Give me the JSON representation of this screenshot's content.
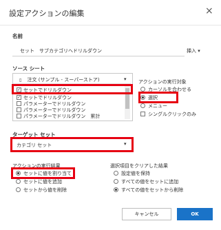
{
  "dialog": {
    "title": "設定アクションの編集",
    "close_glyph": "×"
  },
  "name_section": {
    "label": "名前",
    "value": "セット　サブカテゴリへドリルダウン",
    "insert_label": "挿入"
  },
  "source_sheet": {
    "label": "ソース シート",
    "datasource": "注文 (サンプル - スーパーストア)",
    "items": [
      {
        "label": "セットでドリルダウン",
        "checked": true
      },
      {
        "label": "セットでドリルダウン",
        "checked": true
      },
      {
        "label": "パラメーターでドリルダウン",
        "checked": false
      },
      {
        "label": "パラメーターでドリルダウン",
        "checked": false
      },
      {
        "label": "パラメーターでドリルダウン　累計",
        "checked": false
      },
      {
        "label": "パラメーターでドリルダウン　累計",
        "checked": false
      }
    ]
  },
  "run_target": {
    "label": "アクションの実行対象",
    "options": [
      "カーソルを合わせる",
      "選択",
      "メニュー"
    ],
    "selected": "選択",
    "single_click_label": "シングルクリックのみ"
  },
  "target_set": {
    "label": "ターゲット セット",
    "value": "カテゴリ セット"
  },
  "run_result": {
    "label": "アクションの実行結果",
    "options": [
      "セットに値を割り当て",
      "セットに値を追加",
      "セットから値を削除"
    ],
    "selected": "セットに値を割り当て"
  },
  "clear_result": {
    "label": "選択項目をクリアした結果",
    "options": [
      "設定値を保持",
      "すべての値をセットに追加",
      "すべての値をセットから削除"
    ],
    "selected": "すべての値をセットから削除"
  },
  "buttons": {
    "cancel": "キャンセル",
    "ok": "OK"
  },
  "colors": {
    "highlight": "#e60012",
    "primary": "#1a73c8"
  }
}
